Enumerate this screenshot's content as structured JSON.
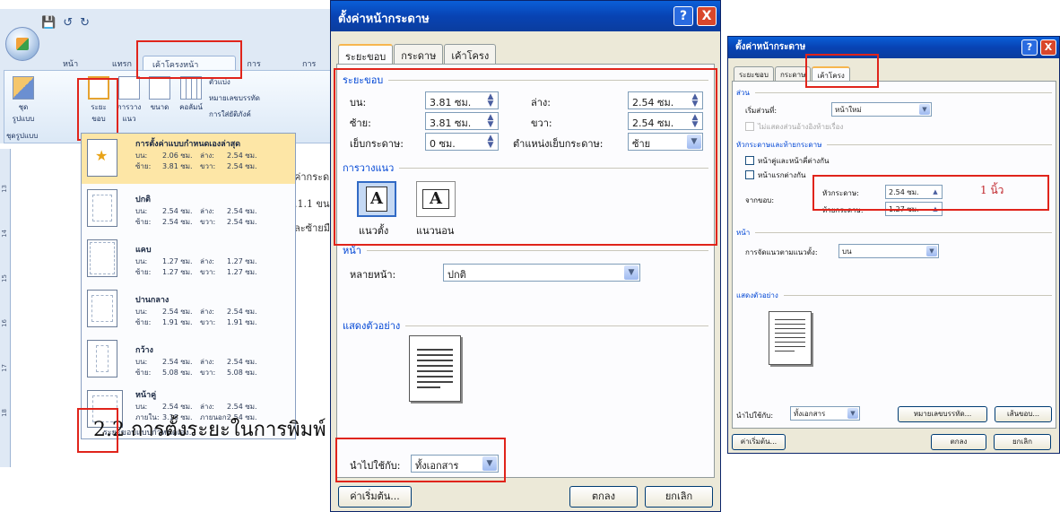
{
  "ribbon": {
    "tabs": [
      "หน้าแรก",
      "แทรก",
      "เค้าโครงหน้ากระดาษ",
      "การอ้างอิง",
      "การส่ง"
    ],
    "active_tab": "เค้าโครงหน้ากระดาษ",
    "buttons": {
      "theme": "ชุด\nรูปแบบ",
      "margins": "ระยะ\nขอบ",
      "orientation": "การวาง\nแนว",
      "size": "ขนาด",
      "columns": "คอลัมน์",
      "breaks": "ตัวแบ่ง",
      "line_numbers": "หมายเลขบรรทัด",
      "hyphenation": "การใส่ยัติภังค์"
    },
    "group_label": "ชุดรูปแบบ"
  },
  "gallery": {
    "items": [
      {
        "title": "การตั้งค่าแบบกำหนดเองล่าสุด",
        "r1": [
          "บน:",
          "2.06 ซม.",
          "ล่าง:",
          "2.54 ซม."
        ],
        "r2": [
          "ซ้าย:",
          "3.81 ซม.",
          "ขวา:",
          "2.54 ซม."
        ]
      },
      {
        "title": "ปกติ",
        "r1": [
          "บน:",
          "2.54 ซม.",
          "ล่าง:",
          "2.54 ซม."
        ],
        "r2": [
          "ซ้าย:",
          "2.54 ซม.",
          "ขวา:",
          "2.54 ซม."
        ]
      },
      {
        "title": "แคบ",
        "r1": [
          "บน:",
          "1.27 ซม.",
          "ล่าง:",
          "1.27 ซม."
        ],
        "r2": [
          "ซ้าย:",
          "1.27 ซม.",
          "ขวา:",
          "1.27 ซม."
        ]
      },
      {
        "title": "ปานกลาง",
        "r1": [
          "บน:",
          "2.54 ซม.",
          "ล่าง:",
          "2.54 ซม."
        ],
        "r2": [
          "ซ้าย:",
          "1.91 ซม.",
          "ขวา:",
          "1.91 ซม."
        ]
      },
      {
        "title": "กว้าง",
        "r1": [
          "บน:",
          "2.54 ซม.",
          "ล่าง:",
          "2.54 ซม."
        ],
        "r2": [
          "ซ้าย:",
          "5.08 ซม.",
          "ขวา:",
          "5.08 ซม."
        ]
      },
      {
        "title": "หน้าคู่",
        "r1": [
          "บน:",
          "2.54 ซม.",
          "ล่าง:",
          "2.54 ซม."
        ],
        "r2": [
          "ภายใน:",
          "3.18 ซม.",
          "ภายนอก:",
          "2.54 ซม."
        ]
      }
    ],
    "footer": "ระยะขอบแบบกำหนดเอง..."
  },
  "document": {
    "snippets": [
      "ค่ากระด",
      ".1.1 ขน",
      "ละซ้ายมือ"
    ],
    "caption": "2.2 การตั้งระยะในการพิมพ์"
  },
  "dialog1": {
    "title": "ตั้งค่าหน้ากระดาษ",
    "help": "?",
    "close": "X",
    "tabs": [
      "ระยะขอบ",
      "กระดาษ",
      "เค้าโครง"
    ],
    "margins_section": "ระยะขอบ",
    "top_label": "บน:",
    "top_value": "3.81 ซม.",
    "bottom_label": "ล่าง:",
    "bottom_value": "2.54 ซม.",
    "left_label": "ซ้าย:",
    "left_value": "3.81 ซม.",
    "right_label": "ขวา:",
    "right_value": "2.54 ซม.",
    "gutter_label": "เย็บกระดาษ:",
    "gutter_value": "0 ซม.",
    "gutter_pos_label": "ตำแหน่งเย็บกระดาษ:",
    "gutter_pos_value": "ซ้าย",
    "orientation_section": "การวางแนว",
    "portrait": "แนวตั้ง",
    "landscape": "แนวนอน",
    "orient_glyph": "A",
    "pages_section": "หน้า",
    "multiple_pages_label": "หลายหน้า:",
    "multiple_pages_value": "ปกติ",
    "preview_section": "แสดงตัวอย่าง",
    "apply_label": "นำไปใช้กับ:",
    "apply_value": "ทั้งเอกสาร",
    "default_button": "ค่าเริ่มต้น...",
    "ok_button": "ตกลง",
    "cancel_button": "ยกเลิก"
  },
  "dialog2": {
    "title": "ตั้งค่าหน้ากระดาษ",
    "help": "?",
    "close": "X",
    "tabs": [
      "ระยะขอบ",
      "กระดาษ",
      "เค้าโครง"
    ],
    "section_section": "ส่วน",
    "section_start_label": "เริ่มส่วนที่:",
    "section_start_value": "หน้าใหม่",
    "suppress_endnotes": "ไม่แสดงส่วนอ้างอิงท้ายเรื่อง",
    "hf_section": "หัวกระดาษและท้ายกระดาษ",
    "odd_even": "หน้าคู่และหน้าคี่ต่างกัน",
    "first_page": "หน้าแรกต่างกัน",
    "from_edge": "จากขอบ:",
    "header_label": "หัวกระดาษ:",
    "header_value": "2.54 ซม.",
    "footer_label": "ท้ายกระดาษ:",
    "footer_value": "1.27 ซม.",
    "note": "1  นิ้ว",
    "page_section": "หน้า",
    "valign_label": "การจัดแนวตามแนวตั้ง:",
    "valign_value": "บน",
    "preview_section": "แสดงตัวอย่าง",
    "apply_label": "นำไปใช้กับ:",
    "apply_value": "ทั้งเอกสาร",
    "line_numbers_button": "หมายเลขบรรทัด...",
    "borders_button": "เส้นขอบ...",
    "default_button": "ค่าเริ่มต้น...",
    "ok_button": "ตกลง",
    "cancel_button": "ยกเลิก"
  },
  "colors": {
    "highlight": "#e0241b",
    "title_bar": "#0843b3",
    "section_text": "#0046d5"
  }
}
